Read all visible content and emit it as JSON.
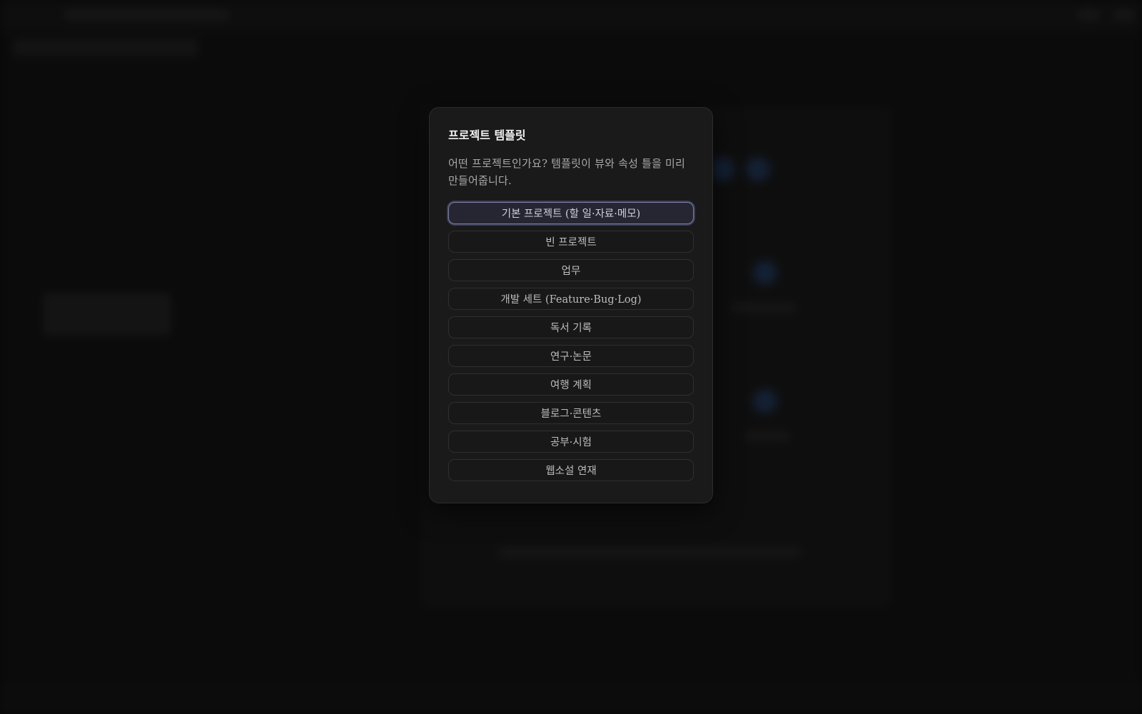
{
  "dialog": {
    "title": "프로젝트 템플릿",
    "description": "어떤 프로젝트인가요? 템플릿이 뷰와 속성 틀을 미리 만들어줍니다.",
    "options": [
      {
        "label": "기본 프로젝트 (할 일·자료·메모)",
        "selected": true
      },
      {
        "label": "빈 프로젝트",
        "selected": false
      },
      {
        "label": "업무",
        "selected": false
      },
      {
        "label": "개발 세트 (Feature·Bug·Log)",
        "selected": false
      },
      {
        "label": "독서 기록",
        "selected": false
      },
      {
        "label": "연구·논문",
        "selected": false
      },
      {
        "label": "여행 계획",
        "selected": false
      },
      {
        "label": "블로그·콘텐츠",
        "selected": false
      },
      {
        "label": "공부·시험",
        "selected": false
      },
      {
        "label": "웹소설 연재",
        "selected": false
      }
    ]
  },
  "colors": {
    "accent_border": "#7b7ea8",
    "dialog_bg": "#1a1a1a",
    "page_bg": "#0f0f0f"
  }
}
